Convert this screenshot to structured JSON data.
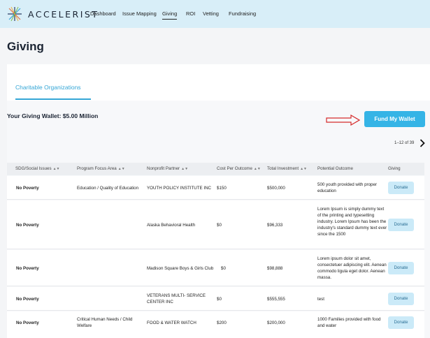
{
  "nav": {
    "brand": "ACCELERIST",
    "items": [
      "Dashboard",
      "Issue Mapping",
      "Giving",
      "ROI",
      "Vetting",
      "Fundraising"
    ],
    "active": "Giving"
  },
  "page": {
    "title": "Giving"
  },
  "tabs": [
    {
      "label": "Charitable Organizations",
      "active": true
    }
  ],
  "wallet": {
    "text": "Your Giving Wallet: $5.00 Million",
    "fund_button": "Fund My Wallet"
  },
  "pagination": {
    "text": "1–12 of 39"
  },
  "table": {
    "headers": [
      "SDG/Social Issues",
      "Program Focus Area",
      "Nonprofit Partner",
      "Cost Per Outcome",
      "Total Investment",
      "Potential Outcome",
      "Giving"
    ],
    "rows": [
      {
        "issue": "No Poverty",
        "focus": "Education / Quality of Education",
        "partner": "YOUTH POLICY INSTITUTE INC",
        "cost": "$150",
        "investment": "$500,000",
        "outcome": "500 youth provided with proper education",
        "action": "Donate"
      },
      {
        "issue": "No Poverty",
        "focus": "",
        "partner": "Alaska Behavioral Health",
        "cost": "$0",
        "investment": "$96,333",
        "outcome": "Lorem Ipsum is simply dummy text of the printing and typesetting industry. Lorem Ipsum has been the industry's standard dummy text ever since the 1500",
        "action": "Donate"
      },
      {
        "issue": "No Poverty",
        "focus": "",
        "partner": "Madison Square Boys & Girls Club",
        "cost": "$0",
        "investment": "$98,888",
        "outcome": "Lorem ipsum dolor sit amet, consectetuer adipiscing elit. Aenean commodo ligula eget dolor. Aenean massa.",
        "action": "Donate"
      },
      {
        "issue": "No Poverty",
        "focus": "",
        "partner": "VETERANS MULTI- SERVICE CENTER INC",
        "cost": "$0",
        "investment": "$555,555",
        "outcome": "test",
        "action": "Donate"
      },
      {
        "issue": "No Poverty",
        "focus": "Critical Human Needs / Child Welfare",
        "partner": "FOOD & WATER WATCH",
        "cost": "$200",
        "investment": "$200,000",
        "outcome": "1000 Families provided with food and water",
        "action": "Donate"
      }
    ]
  },
  "colors": {
    "nav_bg": "#d8eef8",
    "accent": "#35b4e6",
    "donate_bg": "#cbeaf8",
    "annotation_arrow": "#d62b2b"
  }
}
